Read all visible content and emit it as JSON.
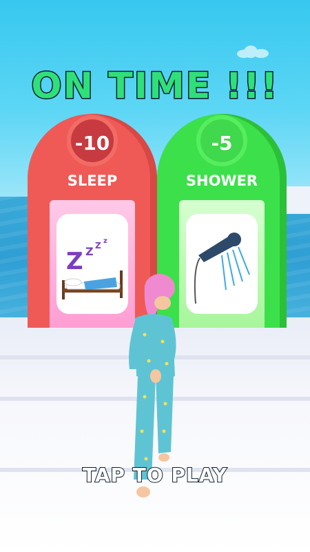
{
  "title": "ON TIME !!!",
  "gates": [
    {
      "value": "-10",
      "label": "SLEEP",
      "icon": "sleep-icon",
      "color": "#ef5a56"
    },
    {
      "value": "-5",
      "label": "SHOWER",
      "icon": "shower-icon",
      "color": "#3ce04a"
    }
  ],
  "prompt": "TAP TO PLAY",
  "colors": {
    "title": "#2fe07a",
    "outline": "#0a1d2c",
    "sky": "#37c8ef",
    "sea": "#2f9fd4"
  }
}
